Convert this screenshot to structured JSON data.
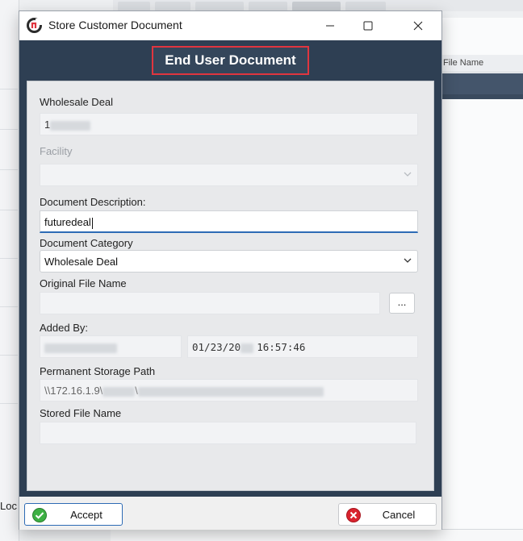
{
  "background": {
    "partial_label": "Loc",
    "grid_header_text": "File Name"
  },
  "window": {
    "title": "Store Customer Document",
    "minimize_symbol": "—",
    "maximize_symbol": "☐",
    "close_symbol": "✕"
  },
  "header": {
    "title": "End User Document"
  },
  "form": {
    "wholesale_deal_label": "Wholesale Deal",
    "wholesale_deal_value": "1",
    "facility_label": "Facility",
    "facility_value": "",
    "document_description_label": "Document Description:",
    "document_description_value": "futuredeal",
    "document_category_label": "Document Category",
    "document_category_value": "Wholesale Deal",
    "original_file_name_label": "Original File Name",
    "original_file_name_value": "",
    "browse_label": "...",
    "added_by_label": "Added By:",
    "added_by_value": "",
    "added_date_prefix": "01/23/20",
    "added_time": "16:57:46",
    "permanent_storage_path_label": "Permanent Storage Path",
    "permanent_storage_path_prefix": "\\\\172.16.1.9\\",
    "stored_file_name_label": "Stored File Name",
    "stored_file_name_value": ""
  },
  "footer": {
    "accept_label": "Accept",
    "cancel_label": "Cancel"
  },
  "colors": {
    "header_bg": "#2e3f53",
    "highlight_border": "#e0353f",
    "accept_icon": "#3cb043",
    "cancel_icon": "#d9232e",
    "focus_underline": "#2d6bb5"
  },
  "icons": {
    "app": "app-logo-icon",
    "dropdown": "chevron-down-icon",
    "accept": "check-circle-icon",
    "cancel": "x-circle-icon"
  }
}
